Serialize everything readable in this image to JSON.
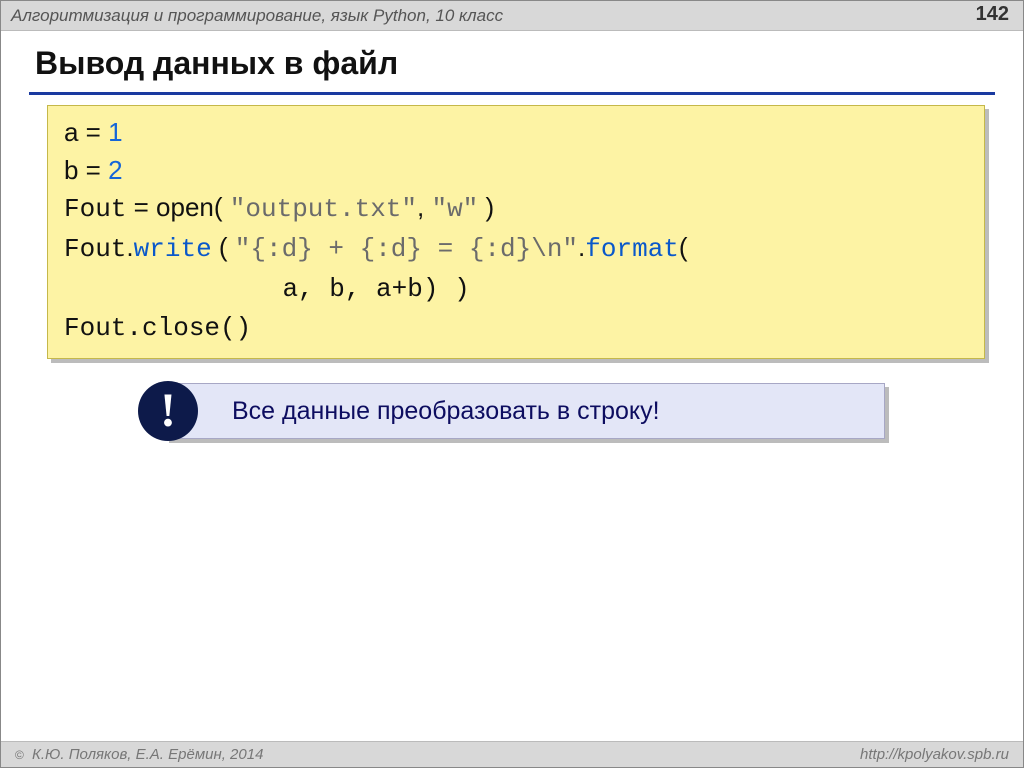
{
  "header": {
    "course": "Алгоритмизация и программирование, язык Python, 10 класс",
    "page": "142"
  },
  "title": "Вывод данных в файл",
  "code": {
    "l1_a": "a = ",
    "l1_v": "1",
    "l2_a": "b = ",
    "l2_v": "2",
    "l3_a": "Fout",
    "l3_b": " = open( ",
    "l3_s1": "\"output.txt\"",
    "l3_c": ", ",
    "l3_s2": "\"w\"",
    "l3_d": " )",
    "l4_a": "Fout",
    "l4_b": ".",
    "l4_w": "write",
    "l4_c": " ( ",
    "l4_s": "\"{:d} + {:d} = {:d}\\n\"",
    "l4_d": ".",
    "l4_f": "format",
    "l4_e": "(",
    "l5_pad": "              ",
    "l5_a": "a, b, a+b) )",
    "l6_a": "Fout",
    "l6_b": ".close()"
  },
  "callout": {
    "badge": "!",
    "text": "Все данные преобразовать в строку!"
  },
  "footer": {
    "copyright_symbol": "©",
    "authors": " К.Ю. Поляков, Е.А. Ерёмин, 2014",
    "url": "http://kpolyakov.spb.ru"
  }
}
